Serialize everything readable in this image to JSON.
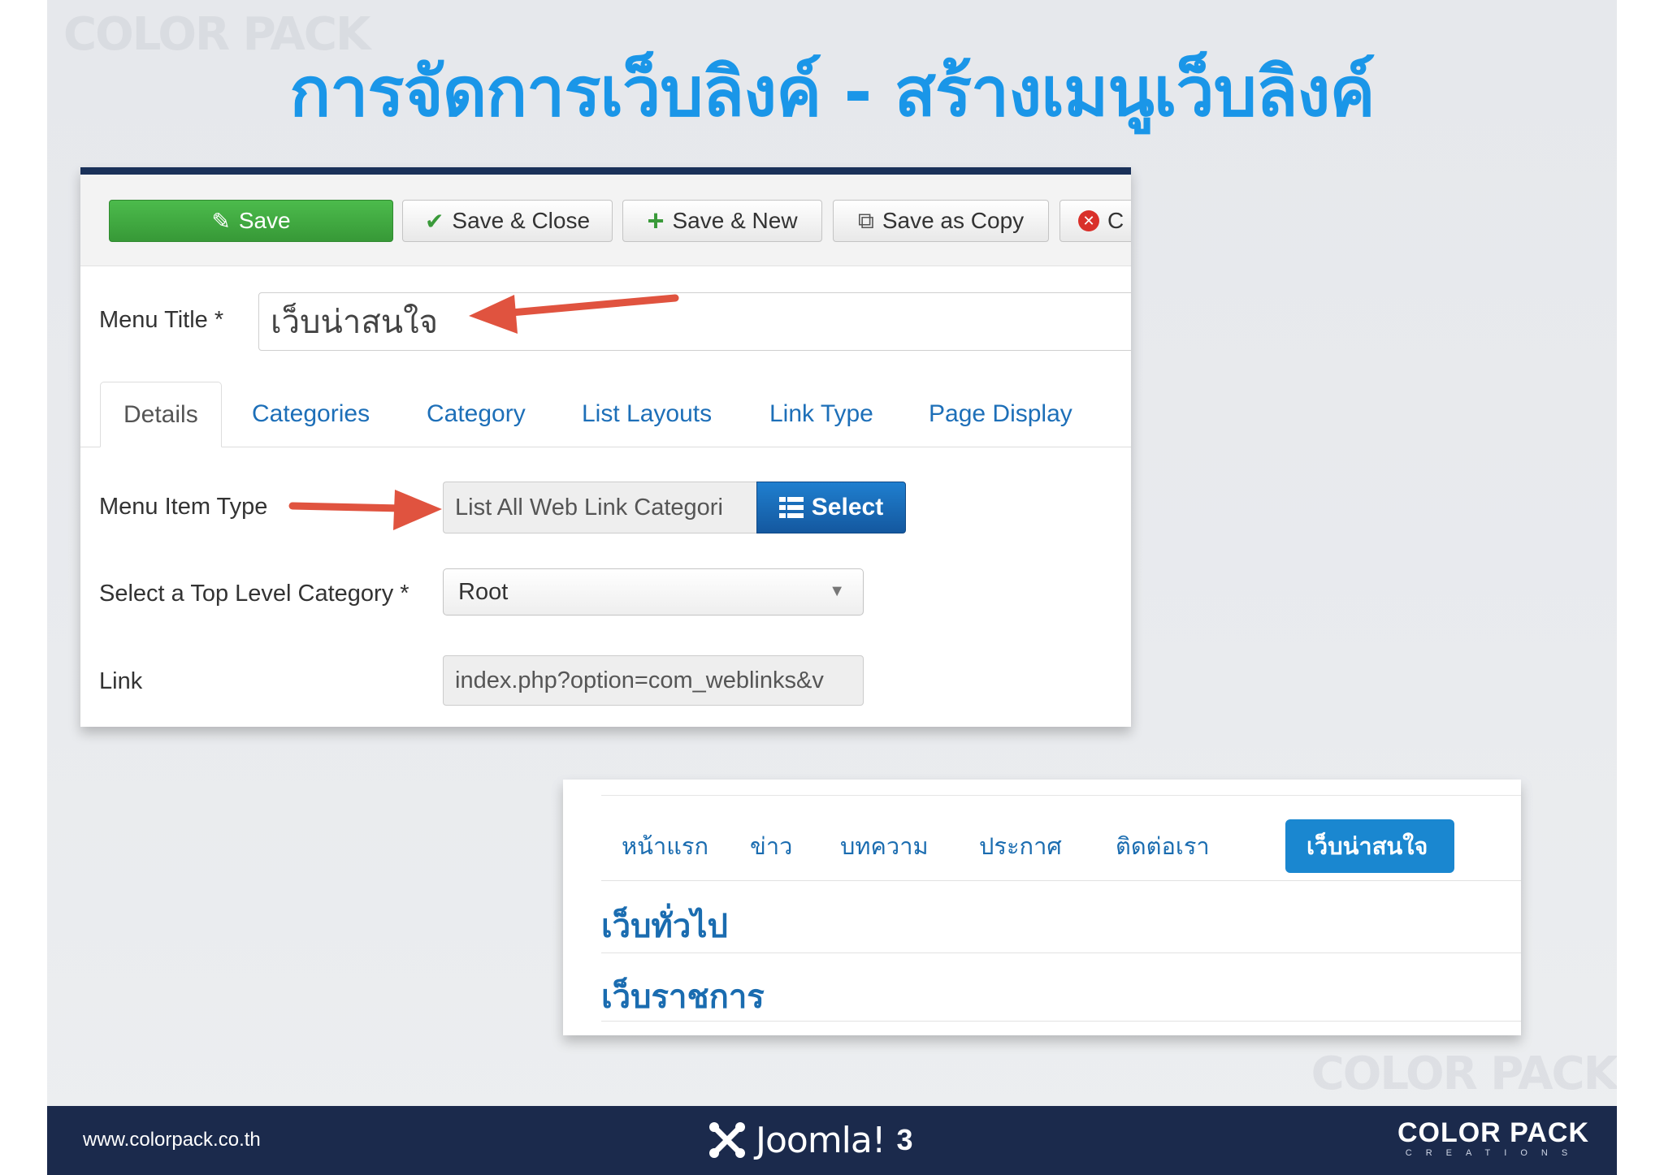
{
  "slide": {
    "title": "การจัดการเว็บลิงค์ - สร้างเมนูเว็บลิงค์"
  },
  "toolbar": {
    "save_label": "Save",
    "save_close_label": "Save & Close",
    "save_new_label": "Save & New",
    "save_copy_label": "Save as Copy",
    "close_label": "C"
  },
  "form": {
    "menu_title_label": "Menu Title *",
    "menu_title_value": "เว็บน่าสนใจ",
    "tabs": [
      "Details",
      "Categories",
      "Category",
      "List Layouts",
      "Link Type",
      "Page Display"
    ],
    "menu_item_type_label": "Menu Item Type",
    "menu_item_type_value": "List All Web Link Categori",
    "select_label": "Select",
    "top_level_label": "Select a Top Level Category *",
    "top_level_value": "Root",
    "link_label": "Link",
    "link_value": "index.php?option=com_weblinks&v"
  },
  "site_menu": {
    "items": [
      "หน้าแรก",
      "ข่าว",
      "บทความ",
      "ประกาศ",
      "ติดต่อเรา",
      "เว็บน่าสนใจ"
    ],
    "active_index": 5,
    "categories": [
      "เว็บทั่วไป",
      "เว็บราชการ"
    ]
  },
  "footer": {
    "url": "www.colorpack.co.th",
    "joomla_text": "Joomla!",
    "joomla_version": "3",
    "brand_main": "COLOR PACK",
    "brand_sub": "CREATIONS"
  },
  "watermark": {
    "text": "COLOR PACK"
  },
  "colors": {
    "title_blue": "#1a96e8",
    "save_green": "#3fa93f",
    "select_blue": "#1769b5",
    "menu_active": "#1a87d0",
    "footer_navy": "#1b2a4c",
    "arrow_red": "#e0533f"
  }
}
